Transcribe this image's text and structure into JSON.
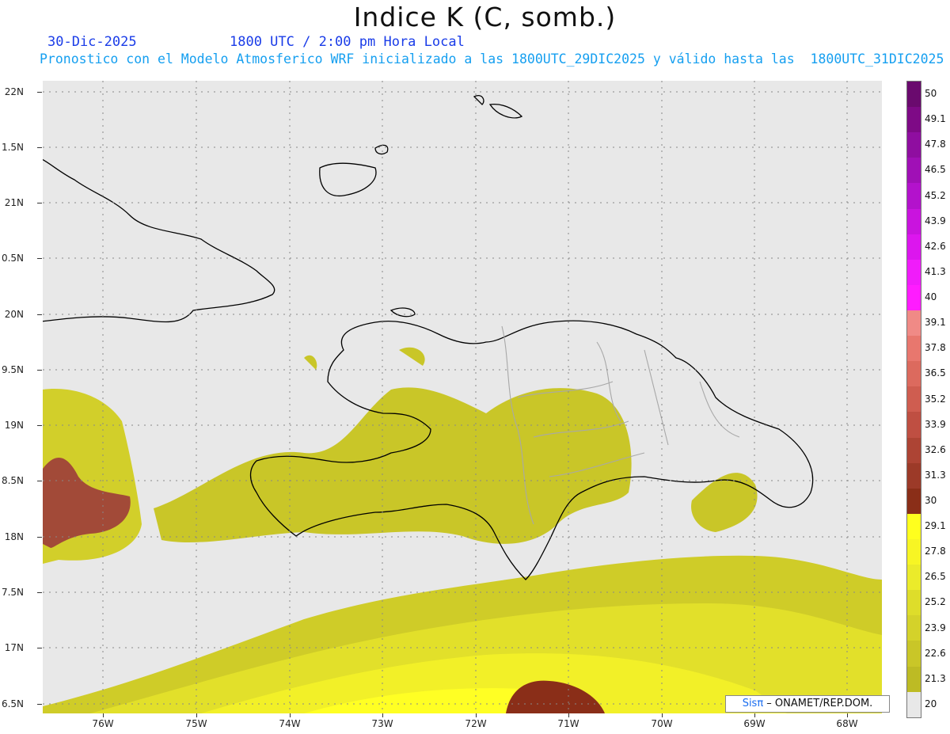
{
  "header": {
    "title": "Indice K (C, somb.)",
    "date": "30-Dic-2025",
    "time": "1800 UTC / 2:00 pm Hora Local",
    "description": "Pronostico con el Modelo Atmosferico WRF inicializado a las 1800UTC_29DIC2025 y válido hasta las  1800UTC_31DIC2025"
  },
  "axes": {
    "lat_labels": [
      "22N",
      "1.5N",
      "21N",
      "0.5N",
      "20N",
      "9.5N",
      "19N",
      "8.5N",
      "18N",
      "7.5N",
      "17N",
      "6.5N"
    ],
    "lon_labels": [
      "76W",
      "75W",
      "74W",
      "73W",
      "72W",
      "71W",
      "70W",
      "69W",
      "68W"
    ]
  },
  "colorbar": {
    "labels": [
      "50",
      "49.1",
      "47.8",
      "46.5",
      "45.2",
      "43.9",
      "42.6",
      "41.3",
      "40",
      "39.1",
      "37.8",
      "36.5",
      "35.2",
      "33.9",
      "32.6",
      "31.3",
      "30",
      "29.1",
      "27.8",
      "26.5",
      "25.2",
      "23.9",
      "22.6",
      "21.3",
      "20"
    ],
    "colors": [
      "#6a0a6e",
      "#7e0a86",
      "#8f0ea0",
      "#a010b6",
      "#b312cc",
      "#c914de",
      "#dc16ee",
      "#f01cfa",
      "#ff1cff",
      "#f08a86",
      "#e8776e",
      "#dc6a5e",
      "#cf5d50",
      "#bf4f42",
      "#ad4434",
      "#9c3a28",
      "#8a2e18",
      "#ffff1e",
      "#f7f524",
      "#ebeb2a",
      "#dedd2a",
      "#d4d22a",
      "#c9c628",
      "#bdbb24",
      "#e8e8e8"
    ]
  },
  "credit": {
    "brand": "Sisπ",
    "org": " – ONAMET/REP.DOM."
  }
}
